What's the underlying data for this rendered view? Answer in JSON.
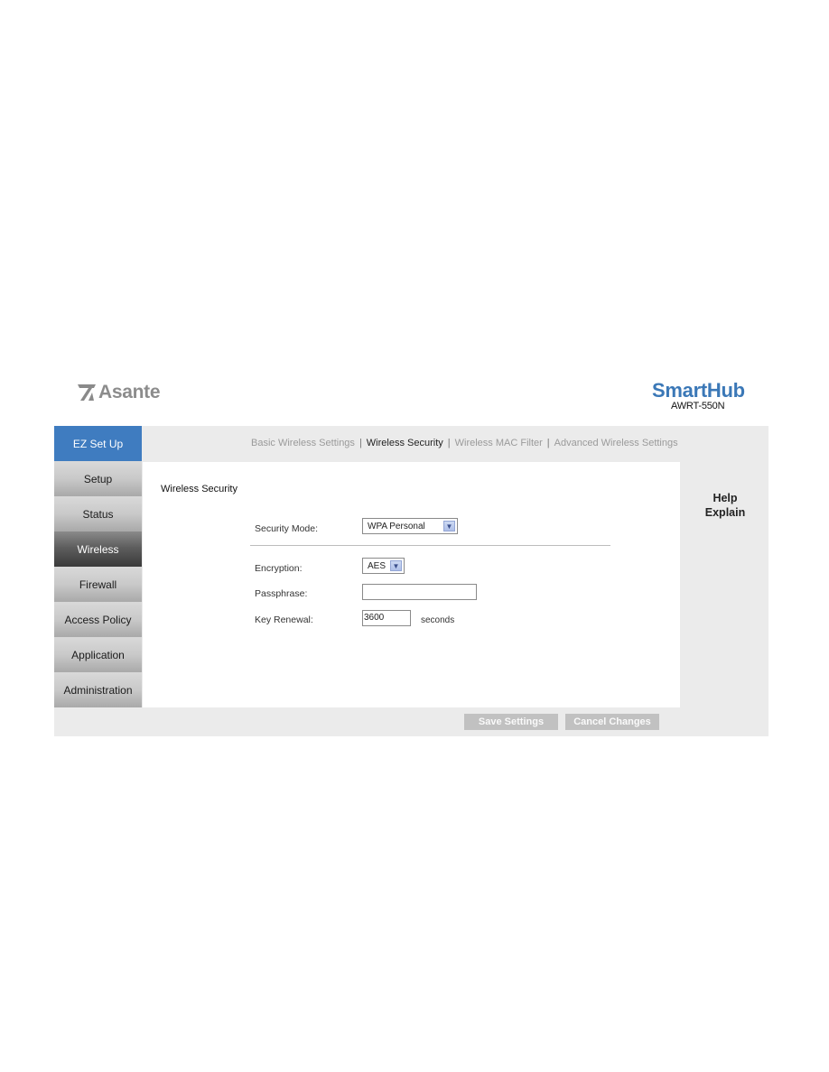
{
  "header": {
    "brand_left": "Asante",
    "brand_left_icon": "asante-logo-icon",
    "brand_right": "SmartHub",
    "model": "AWRT-550N"
  },
  "sidebar": {
    "items": [
      {
        "label": "EZ Set Up",
        "state": "highlight"
      },
      {
        "label": "Setup",
        "state": "normal"
      },
      {
        "label": "Status",
        "state": "normal"
      },
      {
        "label": "Wireless",
        "state": "active"
      },
      {
        "label": "Firewall",
        "state": "normal"
      },
      {
        "label": "Access Policy",
        "state": "normal"
      },
      {
        "label": "Application",
        "state": "normal"
      },
      {
        "label": "Administration",
        "state": "normal"
      }
    ]
  },
  "subnav": {
    "items": [
      {
        "label": "Basic Wireless Settings"
      },
      {
        "label": "Wireless Security",
        "current": true
      },
      {
        "label": "Wireless MAC Filter"
      },
      {
        "label": "Advanced Wireless Settings"
      }
    ],
    "separator": "|"
  },
  "content": {
    "section_title": "Wireless Security",
    "security_mode": {
      "label": "Security Mode:",
      "value": "WPA Personal"
    },
    "encryption": {
      "label": "Encryption:",
      "value": "AES"
    },
    "passphrase": {
      "label": "Passphrase:",
      "value": ""
    },
    "key_renewal": {
      "label": "Key Renewal:",
      "value": "3600",
      "unit": "seconds"
    }
  },
  "help": {
    "line1": "Help",
    "line2": "Explain"
  },
  "actions": {
    "save_label": "Save Settings",
    "cancel_label": "Cancel Changes"
  },
  "colors": {
    "accent_blue": "#3f7cc0",
    "brand_blue": "#3b78b7",
    "panel_gray": "#ebebeb"
  }
}
